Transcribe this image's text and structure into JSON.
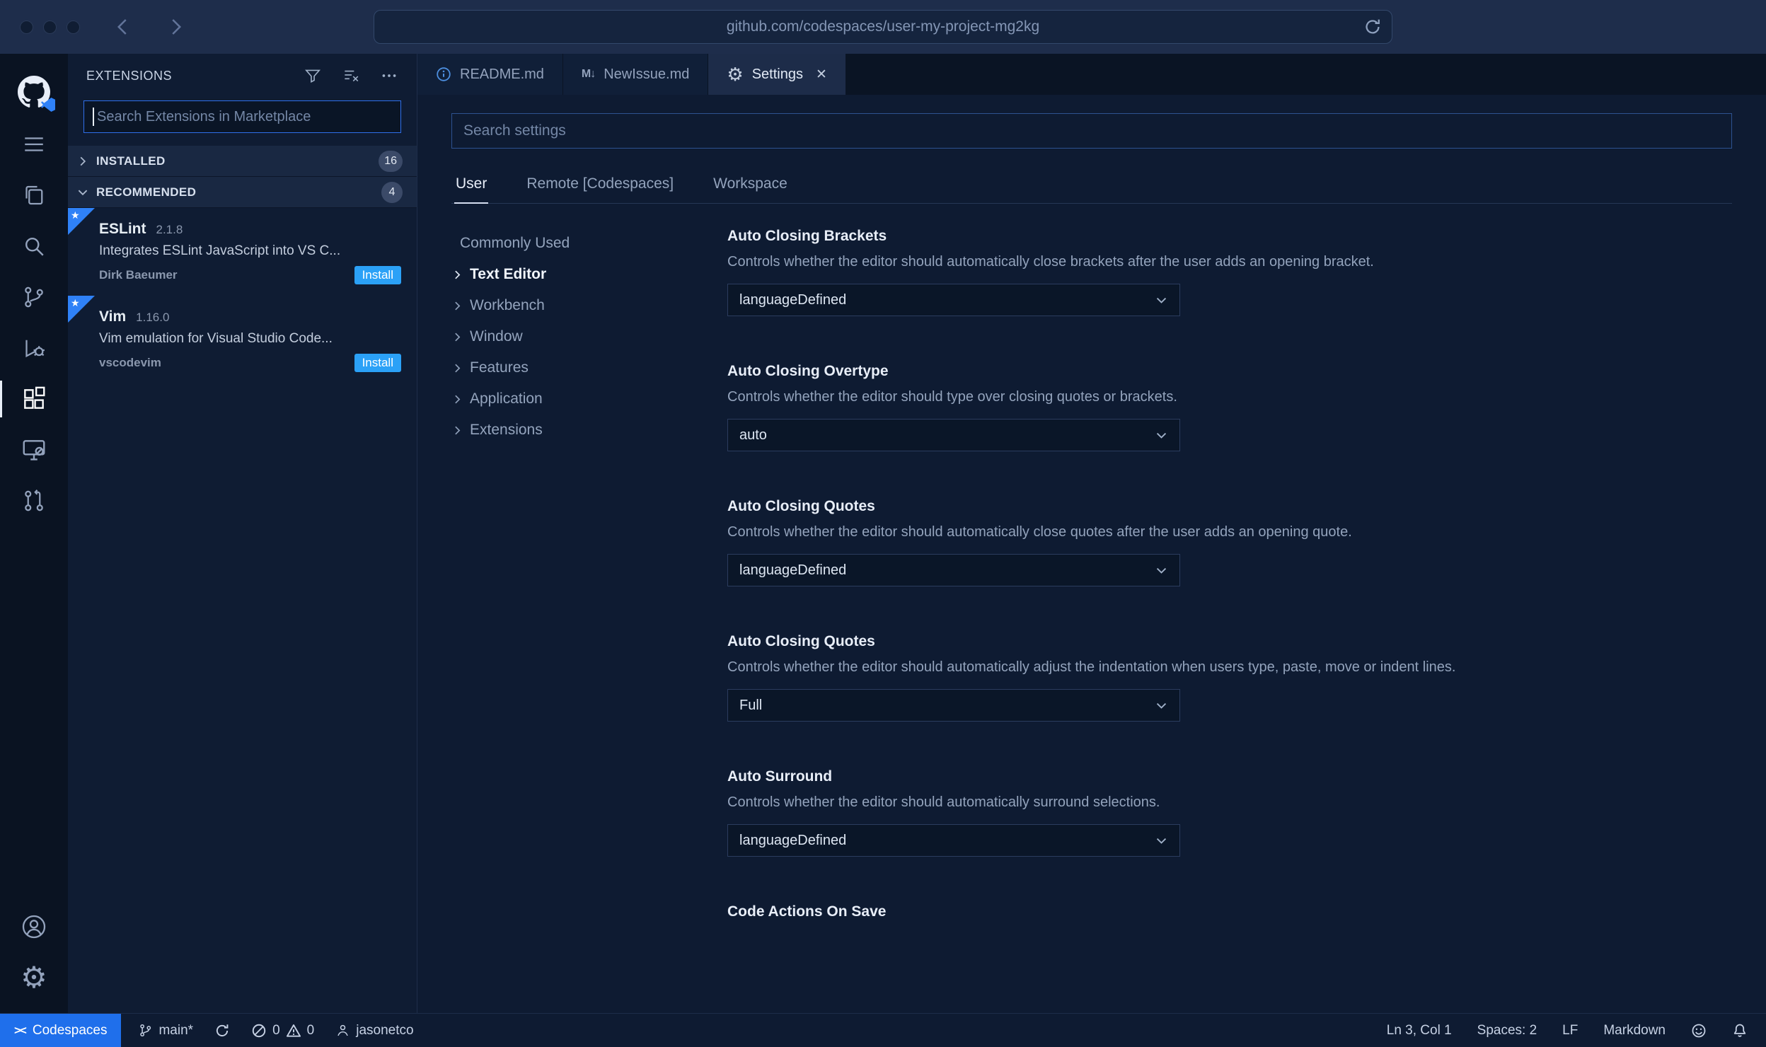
{
  "browser": {
    "url": "github.com/codespaces/user-my-project-mg2kg"
  },
  "sidebar": {
    "title": "EXTENSIONS",
    "search_placeholder": "Search Extensions in Marketplace",
    "sections": [
      {
        "label": "INSTALLED",
        "count": "16"
      },
      {
        "label": "RECOMMENDED",
        "count": "4"
      }
    ],
    "extensions": [
      {
        "name": "ESLint",
        "version": "2.1.8",
        "description": "Integrates ESLint JavaScript into VS C...",
        "author": "Dirk Baeumer",
        "action": "Install"
      },
      {
        "name": "Vim",
        "version": "1.16.0",
        "description": "Vim emulation for Visual Studio Code...",
        "author": "vscodevim",
        "action": "Install"
      }
    ]
  },
  "editor": {
    "tabs": [
      {
        "label": "README.md"
      },
      {
        "label": "NewIssue.md"
      },
      {
        "label": "Settings"
      }
    ],
    "markdown_icon_text": "M↓",
    "gear_glyph": "⚙",
    "close_glyph": "✕"
  },
  "settings": {
    "search_placeholder": "Search settings",
    "scopes": [
      {
        "label": "User"
      },
      {
        "label": "Remote [Codespaces]"
      },
      {
        "label": "Workspace"
      }
    ],
    "toc": [
      {
        "label": "Commonly Used"
      },
      {
        "label": "Text Editor"
      },
      {
        "label": "Workbench"
      },
      {
        "label": "Window"
      },
      {
        "label": "Features"
      },
      {
        "label": "Application"
      },
      {
        "label": "Extensions"
      }
    ],
    "items": [
      {
        "title": "Auto Closing Brackets",
        "description": "Controls whether the editor should automatically close brackets after the user adds an opening bracket.",
        "value": "languageDefined"
      },
      {
        "title": "Auto Closing Overtype",
        "description": "Controls whether the editor should type over closing quotes or brackets.",
        "value": "auto"
      },
      {
        "title": "Auto Closing Quotes",
        "description": "Controls whether the editor should automatically close quotes after the user adds an opening quote.",
        "value": "languageDefined"
      },
      {
        "title": "Auto Closing Quotes",
        "description": "Controls whether the editor should automatically adjust the indentation when users type, paste, move or indent lines.",
        "value": "Full"
      },
      {
        "title": "Auto Surround",
        "description": "Controls whether the editor should automatically surround selections.",
        "value": "languageDefined"
      }
    ],
    "next_item_title": "Code Actions On Save"
  },
  "status_bar": {
    "codespaces": "Codespaces",
    "codespaces_icon_text": "><",
    "branch": "main*",
    "errors": "0",
    "warnings": "0",
    "user": "jasonetco",
    "line_col": "Ln 3, Col 1",
    "spaces": "Spaces: 2",
    "eol": "LF",
    "language": "Markdown"
  }
}
